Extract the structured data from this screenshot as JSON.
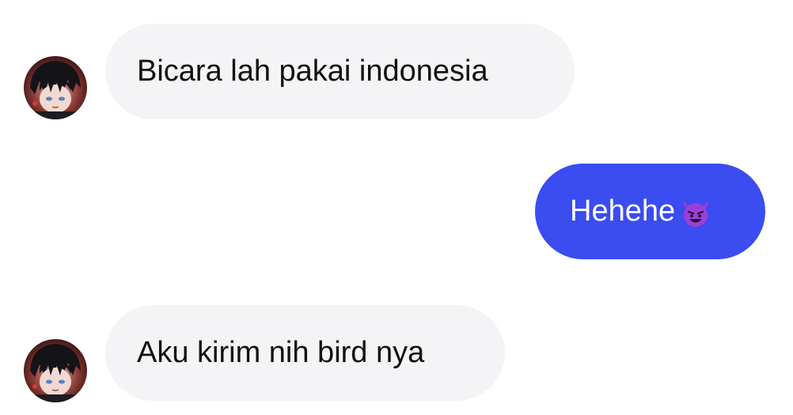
{
  "messages": [
    {
      "direction": "incoming",
      "text": "Bicara lah pakai indonesia",
      "avatar": "anime-profile-avatar"
    },
    {
      "direction": "outgoing",
      "text": "Hehehe",
      "emoji": "smiling-devil-emoji"
    },
    {
      "direction": "incoming",
      "text": "Aku kirim nih bird nya",
      "avatar": "anime-profile-avatar"
    }
  ],
  "colors": {
    "incoming_bubble": "#f4f4f6",
    "outgoing_bubble": "#3b4cf0",
    "incoming_text": "#111111",
    "outgoing_text": "#ffffff",
    "emoji": "#9b3fd6"
  }
}
